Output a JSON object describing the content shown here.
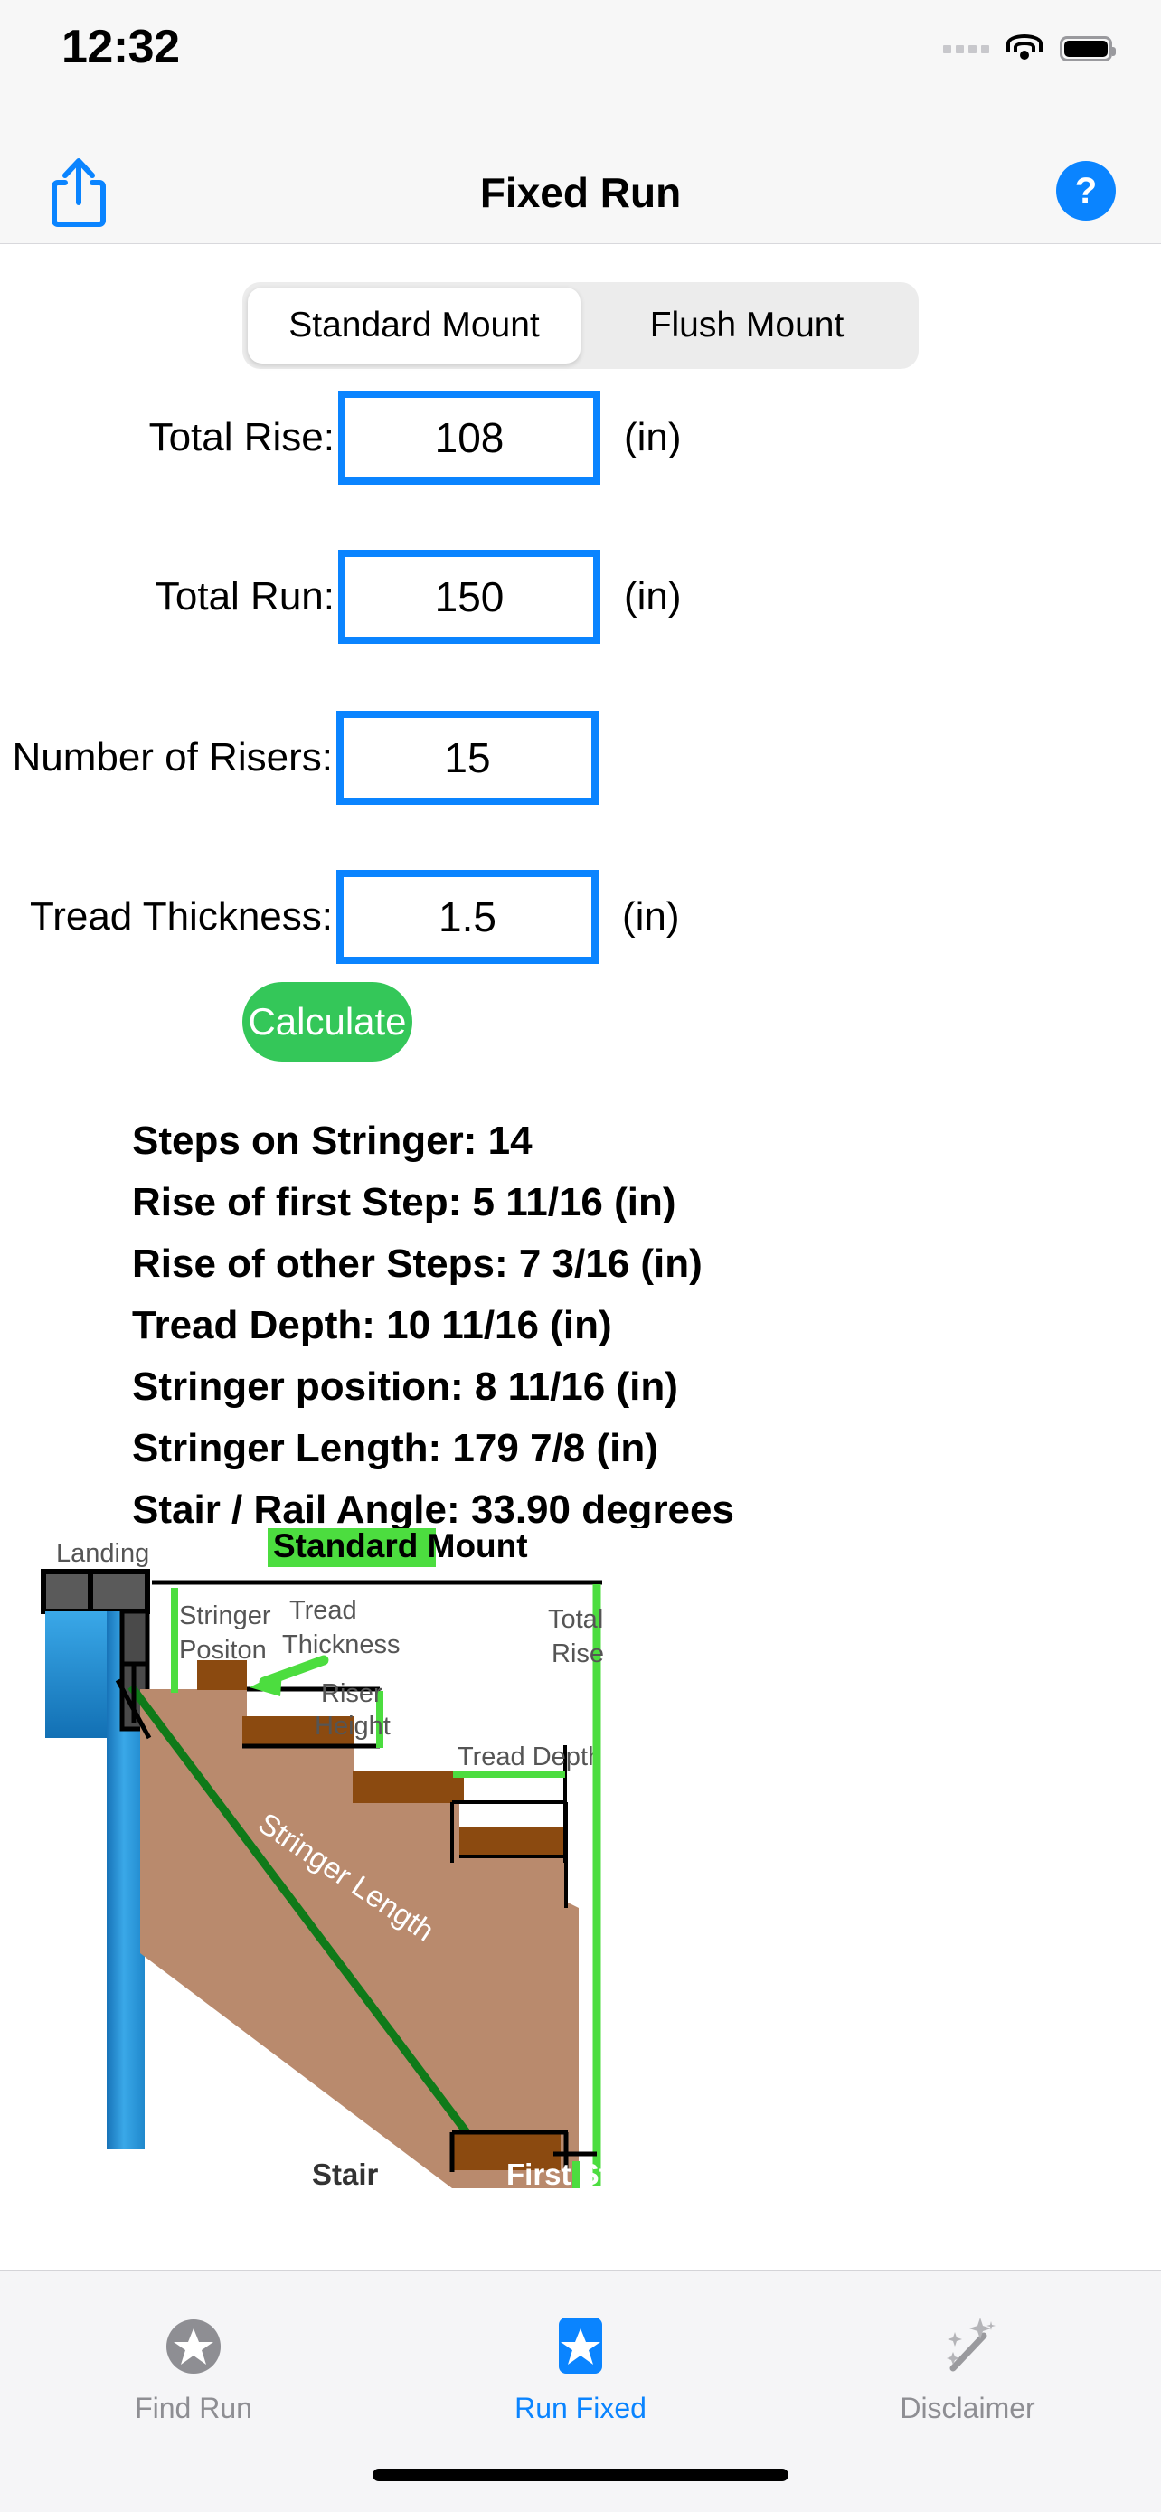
{
  "status_bar": {
    "time": "12:32",
    "signal_icon": "signal-dots-icon",
    "wifi_icon": "wifi-icon",
    "battery_icon": "battery-full-icon"
  },
  "nav": {
    "title": "Fixed Run",
    "share_icon": "share-icon",
    "help_label": "?"
  },
  "segmented": {
    "options": [
      {
        "label": "Standard Mount",
        "selected": true
      },
      {
        "label": "Flush Mount",
        "selected": false
      }
    ]
  },
  "form": {
    "rows": [
      {
        "label": "Total Rise:",
        "value": "108",
        "unit": "(in)"
      },
      {
        "label": "Total Run:",
        "value": "150",
        "unit": "(in)"
      },
      {
        "label": "Number of Risers:",
        "value": "15",
        "unit": ""
      },
      {
        "label": "Tread Thickness:",
        "value": "1.5",
        "unit": "(in)"
      }
    ],
    "calculate_label": "Calculate"
  },
  "results": {
    "lines": [
      "Steps on Stringer: 14",
      "Rise of first Step: 5 11/16 (in)",
      "Rise of other Steps: 7 3/16 (in)",
      "Tread Depth: 10 11/16 (in)",
      "Stringer position: 8 11/16 (in)",
      "Stringer Length: 179 7/8 (in)",
      "Stair / Rail Angle: 33.90 degrees"
    ]
  },
  "diagram": {
    "title": "Standard Mount",
    "labels": {
      "landing": "Landing",
      "stringer_position": "Stringer\nPositon",
      "stringer_position_l1": "Stringer",
      "stringer_position_l2": "Positon",
      "tread_thickness_l1": "Tread",
      "tread_thickness_l2": "Thickness",
      "riser_height_l1": "Riser",
      "riser_height_l2": "Height",
      "tread_depth": "Tread Depth",
      "total_rise_l1": "Total",
      "total_rise_l2": "Rise",
      "stringer_length": "Stringer Length",
      "stair": "Stair",
      "first_step": "First Step"
    },
    "colors": {
      "highlight": "#4cdd3f",
      "stringer_line": "#0f7a19",
      "tread": "#8b4a10",
      "stringer_body": "#b98a6d",
      "dimension_green": "#4cdd3f",
      "wall_blue_top": "#3aa8e8",
      "wall_blue_bottom": "#1773b8",
      "joist_gray": "#5a5a5a"
    }
  },
  "tab_bar": {
    "tabs": [
      {
        "label": "Find Run",
        "icon": "star-circle-icon",
        "active": false
      },
      {
        "label": "Run Fixed",
        "icon": "star-square-icon",
        "active": true
      },
      {
        "label": "Disclaimer",
        "icon": "magic-wand-icon",
        "active": false
      }
    ]
  },
  "theme": {
    "accent_blue": "#0a84ff",
    "green_button": "#34c759",
    "inactive_gray": "#8e8e93"
  }
}
